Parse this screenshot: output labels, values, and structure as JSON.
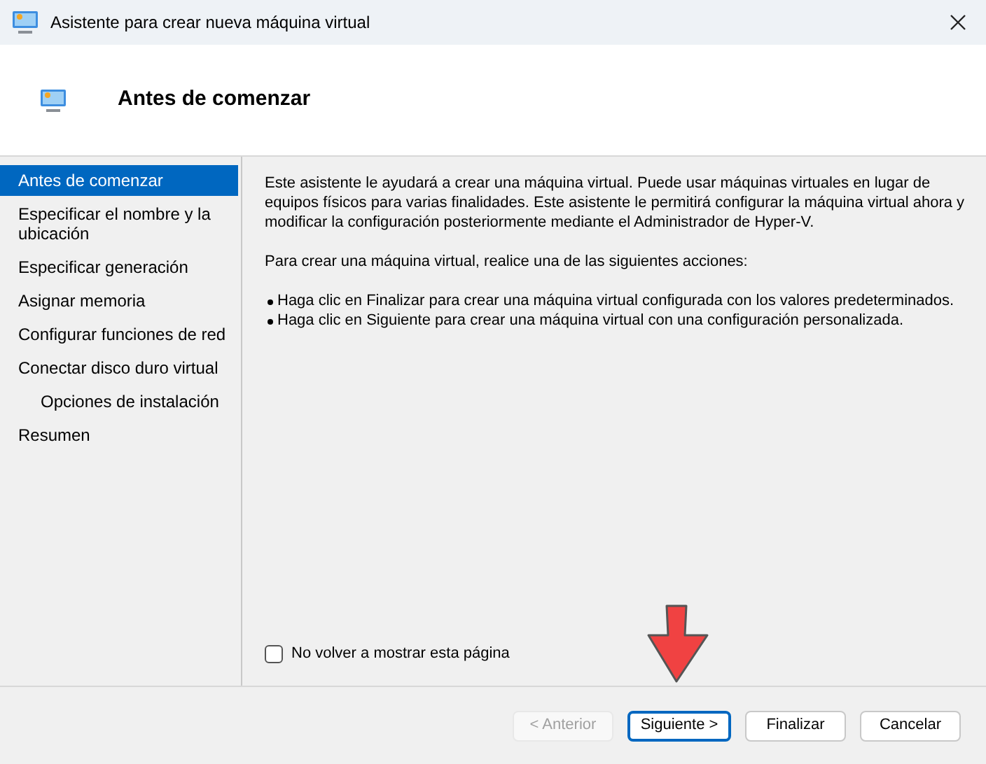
{
  "window": {
    "title": "Asistente para crear nueva máquina virtual"
  },
  "header": {
    "title": "Antes de comenzar"
  },
  "nav": [
    {
      "label": "Antes de comenzar",
      "selected": true
    },
    {
      "label": "Especificar el nombre y la ubicación",
      "selected": false
    },
    {
      "label": "Especificar generación",
      "selected": false
    },
    {
      "label": "Asignar memoria",
      "selected": false
    },
    {
      "label": "Configurar funciones de red",
      "selected": false
    },
    {
      "label": "Conectar disco duro virtual",
      "selected": false,
      "children": [
        {
          "label": "Opciones de instalación",
          "selected": false
        }
      ]
    },
    {
      "label": "Resumen",
      "selected": false
    }
  ],
  "content": {
    "paragraphs": [
      "Este asistente le ayudará a crear una máquina virtual. Puede usar máquinas virtuales en lugar de equipos físicos para varias finalidades. Este asistente le permitirá configurar la máquina virtual ahora y modificar la configuración posteriormente mediante el Administrador de Hyper-V.",
      "Para crear una máquina virtual, realice una de las siguientes acciones:"
    ],
    "bullets": [
      "Haga clic en Finalizar para crear una máquina virtual configurada con los valores predeterminados.",
      "Haga clic en Siguiente para crear una máquina virtual con una configuración personalizada."
    ]
  },
  "checkbox": {
    "label": "No volver a mostrar esta página",
    "checked": false
  },
  "buttons": [
    {
      "label": "< Anterior",
      "disabled": true,
      "default": false
    },
    {
      "label": "Siguiente >",
      "disabled": false,
      "default": true
    },
    {
      "label": "Finalizar",
      "disabled": false,
      "default": false
    },
    {
      "label": "Cancelar",
      "disabled": false,
      "default": false
    }
  ]
}
